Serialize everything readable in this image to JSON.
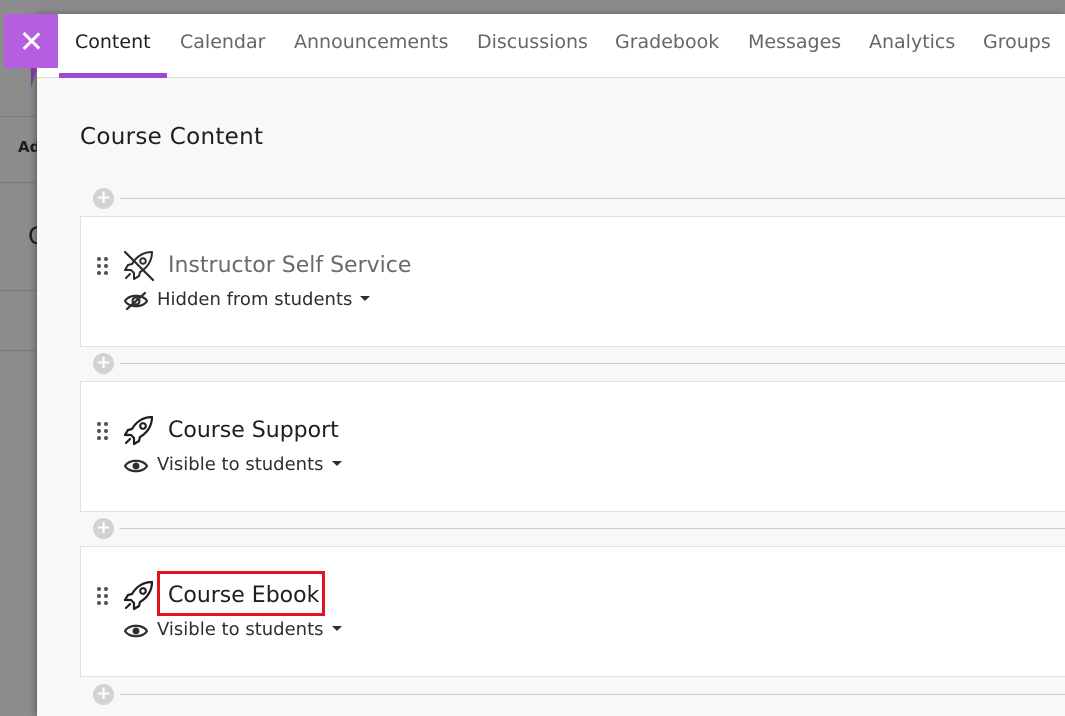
{
  "background": {
    "fragment_1": "Ad",
    "fragment_2": "C"
  },
  "nav": {
    "close_icon": "close-icon",
    "tabs": [
      {
        "label": "Content",
        "active": true
      },
      {
        "label": "Calendar",
        "active": false
      },
      {
        "label": "Announcements",
        "active": false
      },
      {
        "label": "Discussions",
        "active": false
      },
      {
        "label": "Gradebook",
        "active": false
      },
      {
        "label": "Messages",
        "active": false
      },
      {
        "label": "Analytics",
        "active": false
      },
      {
        "label": "Groups",
        "active": false
      }
    ]
  },
  "main": {
    "title": "Course Content",
    "items": [
      {
        "title": "Instructor Self Service",
        "icon": "rocket-icon",
        "visibility": "Hidden from students",
        "visibility_icon": "eye-slash-icon"
      },
      {
        "title": "Course Support",
        "icon": "rocket-icon",
        "visibility": "Visible to students",
        "visibility_icon": "eye-icon"
      },
      {
        "title": "Course Ebook",
        "icon": "rocket-icon",
        "visibility": "Visible to students",
        "visibility_icon": "eye-icon"
      }
    ]
  },
  "colors": {
    "accent": "#a049cf",
    "close_button": "#b45ee0",
    "highlight": "#e0141e"
  }
}
